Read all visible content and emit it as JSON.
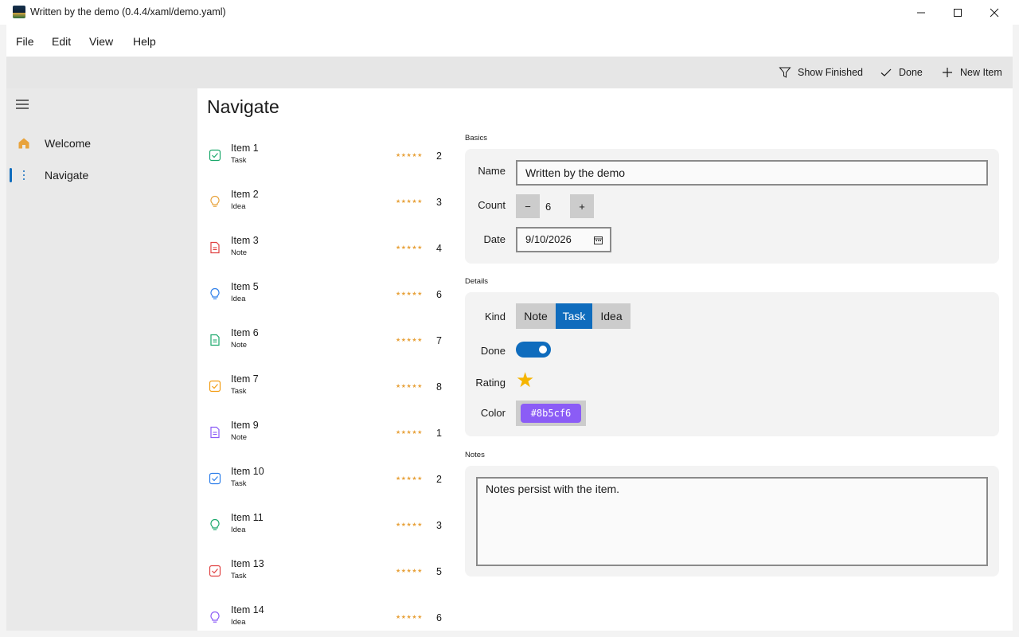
{
  "window": {
    "title": "Written by the demo (0.4.4/xaml/demo.yaml)"
  },
  "menu": {
    "items": [
      "File",
      "Edit",
      "View",
      "Help"
    ]
  },
  "commands": {
    "show_finished": "Show Finished",
    "done": "Done",
    "new_item": "New Item"
  },
  "nav": {
    "items": [
      {
        "label": "Welcome",
        "icon": "home-icon",
        "color": "#e8a33d"
      },
      {
        "label": "Navigate",
        "icon": "more-vertical-icon",
        "color": "#0f6cbd",
        "selected": true
      }
    ]
  },
  "page": {
    "title": "Navigate"
  },
  "list": {
    "items": [
      {
        "title": "Item 1",
        "kind": "Task",
        "stars": "★★★★★",
        "count": "2",
        "icon": "checkbox-icon",
        "color": "#1aa86b"
      },
      {
        "title": "Item 2",
        "kind": "Idea",
        "stars": "★★★★★",
        "count": "3",
        "icon": "lightbulb-icon",
        "color": "#e8a33d"
      },
      {
        "title": "Item 3",
        "kind": "Note",
        "stars": "★★★★★",
        "count": "4",
        "icon": "document-icon",
        "color": "#e04141"
      },
      {
        "title": "Item 5",
        "kind": "Idea",
        "stars": "★★★★★",
        "count": "6",
        "icon": "lightbulb-icon",
        "color": "#2b7de9"
      },
      {
        "title": "Item 6",
        "kind": "Note",
        "stars": "★★★★★",
        "count": "7",
        "icon": "document-icon",
        "color": "#1aa86b"
      },
      {
        "title": "Item 7",
        "kind": "Task",
        "stars": "★★★★★",
        "count": "8",
        "icon": "checkbox-icon",
        "color": "#f39c12"
      },
      {
        "title": "Item 9",
        "kind": "Note",
        "stars": "★★★★★",
        "count": "1",
        "icon": "document-icon",
        "color": "#8b5cf6"
      },
      {
        "title": "Item 10",
        "kind": "Task",
        "stars": "★★★★★",
        "count": "2",
        "icon": "checkbox-icon",
        "color": "#2b7de9"
      },
      {
        "title": "Item 11",
        "kind": "Idea",
        "stars": "★★★★★",
        "count": "3",
        "icon": "lightbulb-icon",
        "color": "#1aa86b"
      },
      {
        "title": "Item 13",
        "kind": "Task",
        "stars": "★★★★★",
        "count": "5",
        "icon": "checkbox-icon",
        "color": "#e04141"
      },
      {
        "title": "Item 14",
        "kind": "Idea",
        "stars": "★★★★★",
        "count": "6",
        "icon": "lightbulb-icon",
        "color": "#8b5cf6"
      }
    ]
  },
  "basics": {
    "section": "Basics",
    "name_label": "Name",
    "name_value": "Written by the demo",
    "count_label": "Count",
    "count_value": "6",
    "minus": "−",
    "plus": "+",
    "date_label": "Date",
    "date_value": "9/10/2026"
  },
  "details": {
    "section": "Details",
    "kind_label": "Kind",
    "kind_options": [
      "Note",
      "Task",
      "Idea"
    ],
    "kind_selected": "Task",
    "done_label": "Done",
    "done_on": true,
    "rating_label": "Rating",
    "rating_star": "★",
    "color_label": "Color",
    "color_value": "#8b5cf6",
    "color_text": "#8b5cf6"
  },
  "notes": {
    "section": "Notes",
    "value": "Notes persist with the item."
  },
  "colors": {
    "accent": "#0f6cbd",
    "star": "#f5b400"
  }
}
